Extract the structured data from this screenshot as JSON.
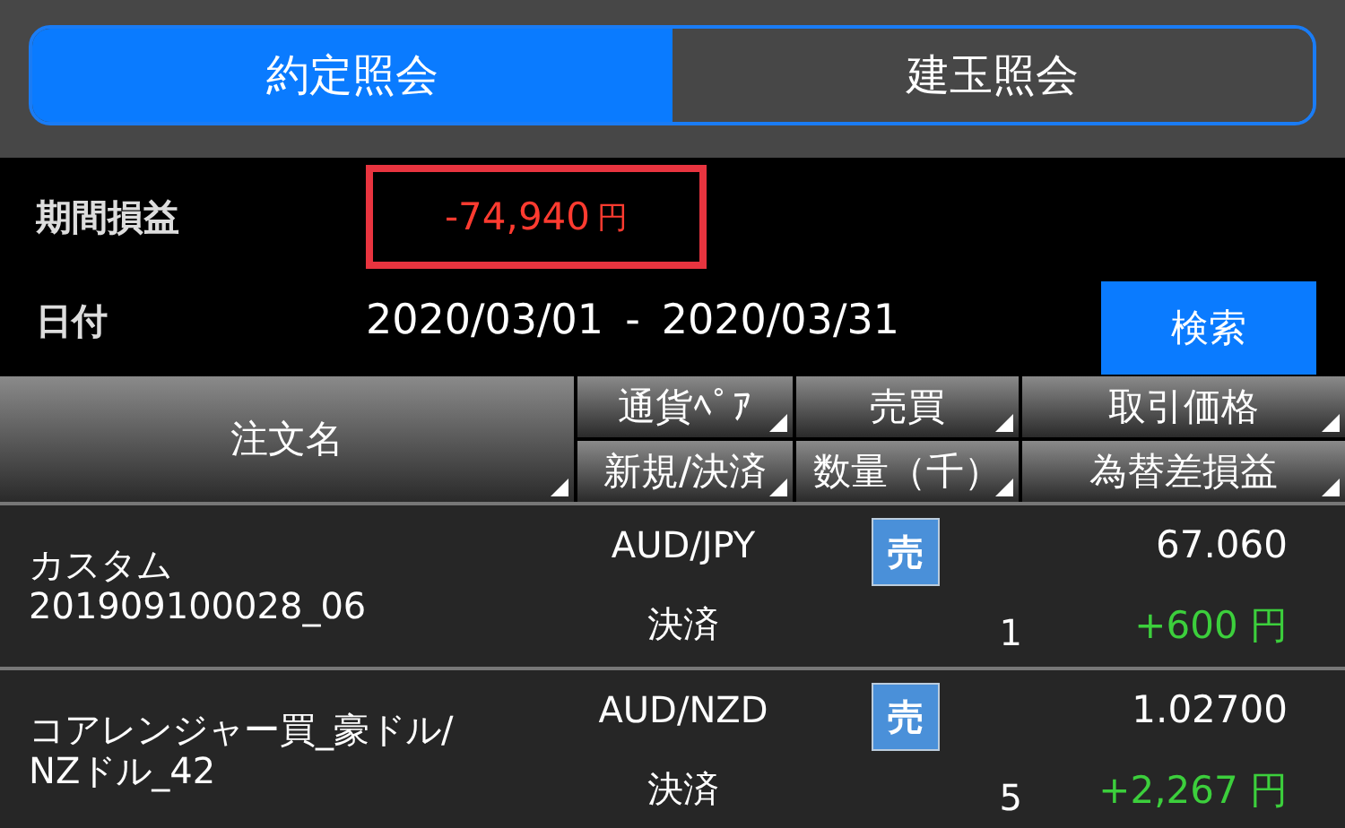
{
  "tabs": [
    {
      "label": "約定照会",
      "selected": true
    },
    {
      "label": "建玉照会",
      "selected": false
    }
  ],
  "summary": {
    "label": "期間損益",
    "value": "-74,940",
    "unit": "円",
    "color": "#ff3b30",
    "highlighted": true
  },
  "date_range": {
    "label": "日付",
    "from": "2020/03/01",
    "separator": "-",
    "to": "2020/03/31"
  },
  "search_button": "検索",
  "table": {
    "name_column": "注文名",
    "columns": [
      [
        "通貨ﾍﾟｱ",
        "新規/決済"
      ],
      [
        "売買",
        "数量（千）"
      ],
      [
        "取引価格",
        "為替差損益"
      ]
    ],
    "rows": [
      {
        "name": "カスタム\n201909100028_06",
        "pair": "AUD/JPY",
        "side": "売",
        "price": "67.060",
        "type": "決済",
        "quantity": "1",
        "pnl": "+600 円",
        "color": "#3ccf3c"
      },
      {
        "name": "コアレンジャー買_豪ドル/\nNZドル_42",
        "pair": "AUD/NZD",
        "side": "売",
        "price": "1.02700",
        "type": "決済",
        "quantity": "5",
        "pnl": "+2,267 円",
        "color": "#3ccf3c"
      }
    ]
  }
}
